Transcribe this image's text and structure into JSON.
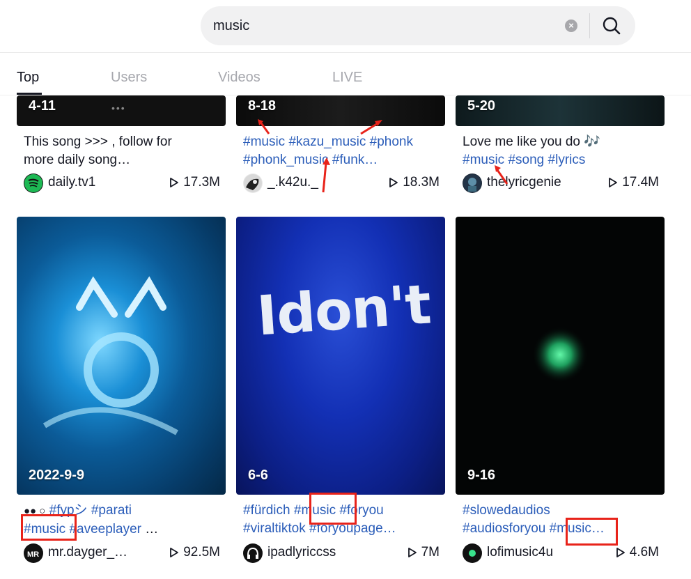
{
  "search": {
    "value": "music"
  },
  "tabs": [
    {
      "label": "Top",
      "active": true
    },
    {
      "label": "Users",
      "active": false
    },
    {
      "label": "Videos",
      "active": false
    },
    {
      "label": "LIVE",
      "active": false
    }
  ],
  "cards": [
    {
      "date": "4-11",
      "caption_line1": "This song >>> , follow for",
      "caption_line2": "more daily song…",
      "author": "daily.tv1",
      "views": "17.3M"
    },
    {
      "date": "8-18",
      "tags_line1": [
        "#music",
        "#kazu_music",
        "#phonk"
      ],
      "tags_line2": [
        "#phonk_music",
        "#funk…"
      ],
      "author": "_.k42u._",
      "views": "18.3M"
    },
    {
      "date": "5-20",
      "caption_line1": "Love me like you do 🎶",
      "tags_line2": [
        "#music",
        "#song",
        "#lyrics"
      ],
      "author": "thelyricgenie",
      "views": "17.4M"
    },
    {
      "date": "2022-9-9",
      "tags_line1": [
        "#fypシ",
        "#parati"
      ],
      "tags_line2": [
        "#music",
        "#aveeplayer",
        "…"
      ],
      "author": "mr.dayger_…",
      "views": "92.5M",
      "thumb_text": ""
    },
    {
      "date": "6-6",
      "tags_line1": [
        "#fürdich",
        "#music",
        "#foryou"
      ],
      "tags_line2": [
        "#viraltiktok",
        "#foryoupage…"
      ],
      "author": "ipadlyriccss",
      "views": "7M",
      "thumb_text": "Idon't"
    },
    {
      "date": "9-16",
      "tags_line1": [
        "#slowedaudios"
      ],
      "tags_line2": [
        "#audiosforyou",
        "#music…"
      ],
      "author": "lofimusic4u",
      "views": "4.6M"
    }
  ],
  "colors": {
    "tag": "#2b5db9",
    "highlight": "#e8231a",
    "text": "#161823"
  }
}
